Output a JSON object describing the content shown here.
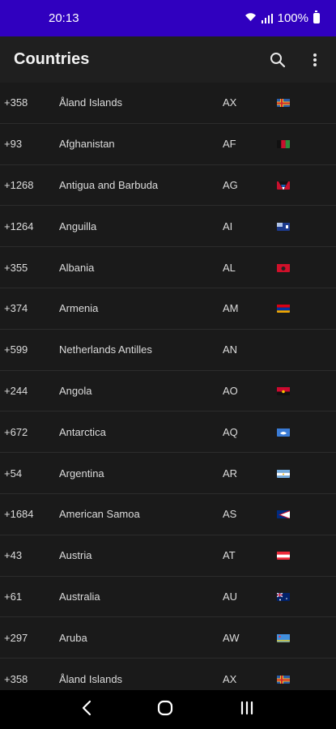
{
  "status_bar": {
    "time": "20:13",
    "battery": "100%",
    "wifi_icon": "wifi-icon",
    "signal_icon": "signal-icon",
    "battery_icon": "battery-icon"
  },
  "app_bar": {
    "title": "Countries",
    "search_icon": "search-icon",
    "menu_icon": "more-vert-icon"
  },
  "colors": {
    "status_bar": "#3000bf",
    "background": "#1a1a1a",
    "divider": "#2c2c2c"
  },
  "countries": [
    {
      "code": "+358",
      "name": "Åland Islands",
      "iso": "AX",
      "flag": "ax-flag"
    },
    {
      "code": "+93",
      "name": "Afghanistan",
      "iso": "AF",
      "flag": "af-flag"
    },
    {
      "code": "+1268",
      "name": "Antigua and Barbuda",
      "iso": "AG",
      "flag": "ag-flag"
    },
    {
      "code": "+1264",
      "name": "Anguilla",
      "iso": "AI",
      "flag": "ai-flag"
    },
    {
      "code": "+355",
      "name": "Albania",
      "iso": "AL",
      "flag": "al-flag"
    },
    {
      "code": "+374",
      "name": "Armenia",
      "iso": "AM",
      "flag": "am-flag"
    },
    {
      "code": "+599",
      "name": "Netherlands Antilles",
      "iso": "AN",
      "flag": ""
    },
    {
      "code": "+244",
      "name": "Angola",
      "iso": "AO",
      "flag": "ao-flag"
    },
    {
      "code": "+672",
      "name": "Antarctica",
      "iso": "AQ",
      "flag": "aq-flag"
    },
    {
      "code": "+54",
      "name": "Argentina",
      "iso": "AR",
      "flag": "ar-flag"
    },
    {
      "code": "+1684",
      "name": "American Samoa",
      "iso": "AS",
      "flag": "as-flag"
    },
    {
      "code": "+43",
      "name": "Austria",
      "iso": "AT",
      "flag": "at-flag"
    },
    {
      "code": "+61",
      "name": "Australia",
      "iso": "AU",
      "flag": "au-flag"
    },
    {
      "code": "+297",
      "name": "Aruba",
      "iso": "AW",
      "flag": "aw-flag"
    },
    {
      "code": "+358",
      "name": "Åland Islands",
      "iso": "AX",
      "flag": "ax-flag"
    }
  ],
  "nav_bar": {
    "back_icon": "back-icon",
    "home_icon": "home-icon",
    "recents_icon": "recents-icon"
  }
}
